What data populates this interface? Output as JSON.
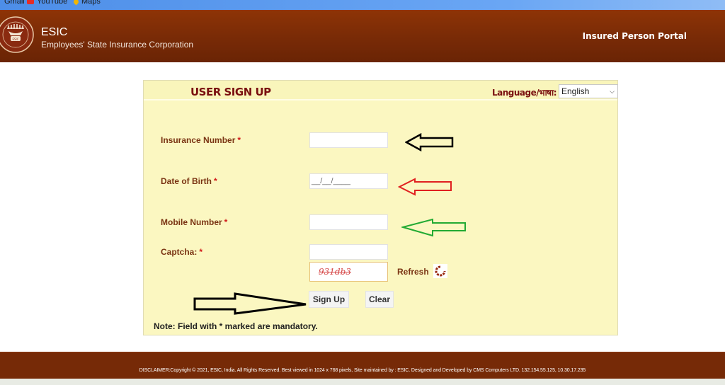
{
  "bookmarks": [
    {
      "label": "Gmail",
      "icon": "gmail-icon"
    },
    {
      "label": "YouTube",
      "icon": "youtube-icon"
    },
    {
      "label": "Maps",
      "icon": "maps-icon"
    }
  ],
  "header": {
    "brand_title": "ESIC",
    "brand_subtitle": "Employees' State Insurance Corporation",
    "portal_name": "Insured Person Portal"
  },
  "form": {
    "title": "USER SIGN UP",
    "language_label": "Language/भाषा:",
    "language_selected": "English",
    "fields": {
      "insurance_number": {
        "label": "Insurance Number",
        "required": "*",
        "value": ""
      },
      "date_of_birth": {
        "label": "Date of Birth",
        "required": "*",
        "value": "__/__/____"
      },
      "mobile_number": {
        "label": "Mobile Number",
        "required": "*",
        "value": ""
      },
      "captcha": {
        "label": "Captcha:",
        "required": "*",
        "value": ""
      }
    },
    "captcha_text": "931db3",
    "refresh_label": "Refresh",
    "signup_label": "Sign Up",
    "clear_label": "Clear",
    "note": "Note: Field with * marked are mandatory."
  },
  "annotations": {
    "arrow_colors": {
      "insurance": "#000000",
      "dob": "#e02020",
      "mobile": "#22aa33",
      "signup": "#000000"
    }
  },
  "footer": {
    "text": "DISCLAIMER:Copyright © 2021, ESIC, India. All Rights Reserved. Best viewed in 1024 x 768 pixels, Site maintained by : ESIC. Designed and Developed by CMS Computers LTD. 132.154.55.125, 10.30.17.235"
  }
}
